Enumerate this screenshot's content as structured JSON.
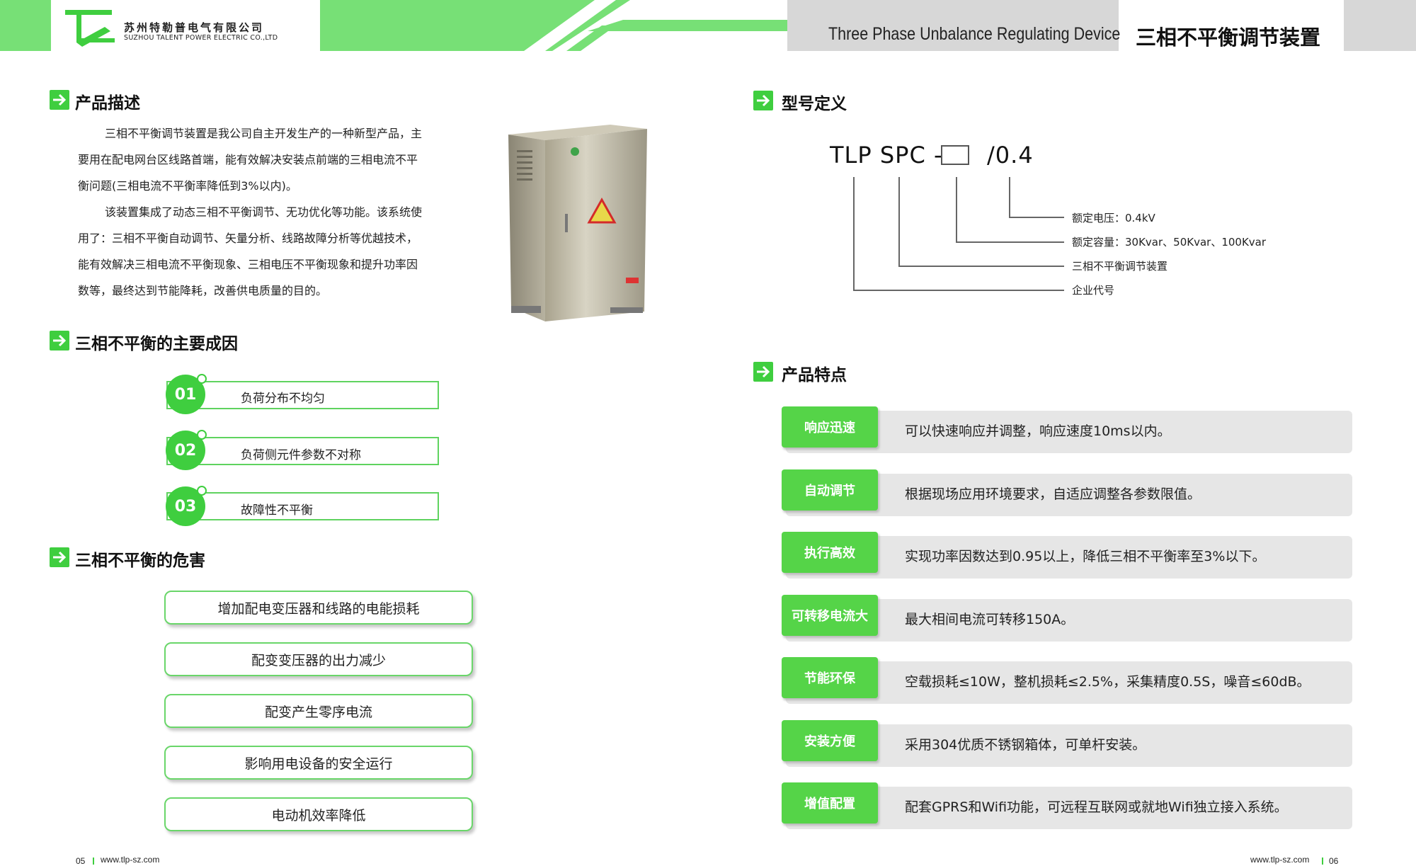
{
  "header": {
    "company_cn": "苏州特勒普电气有限公司",
    "company_en": "SUZHOU TALENT POWER ELECTRIC CO.,LTD",
    "title_en": "Three Phase Unbalance Regulating Device",
    "title_cn": "三相不平衡调节装置"
  },
  "description": {
    "title": "产品描述",
    "p1_l1": "三相不平衡调节装置是我公司自主开发生产的一种新型产品，主",
    "p1_l2": "要用在配电网台区线路首端，能有效解决安装点前端的三相电流不平",
    "p1_l3": "衡问题(三相电流不平衡率降低到3%以内)。",
    "p2_l1": "该装置集成了动态三相不平衡调节、无功优化等功能。该系统使",
    "p2_l2": "用了：三相不平衡自动调节、矢量分析、线路故障分析等优越技术，",
    "p2_l3": "能有效解决三相电流不平衡现象、三相电压不平衡现象和提升功率因",
    "p2_l4": "数等，最终达到节能降耗，改善供电质量的目的。"
  },
  "causes": {
    "title": "三相不平衡的主要成因",
    "items": [
      {
        "num": "01",
        "text": "负荷分布不均匀"
      },
      {
        "num": "02",
        "text": "负荷侧元件参数不对称"
      },
      {
        "num": "03",
        "text": "故障性不平衡"
      }
    ]
  },
  "harms": {
    "title": "三相不平衡的危害",
    "items": [
      "增加配电变压器和线路的电能损耗",
      "配变变压器的出力减少",
      "配变产生零序电流",
      "影响用电设备的安全运行",
      "电动机效率降低"
    ]
  },
  "model": {
    "title": "型号定义",
    "prefix": "TLP SPC -",
    "suffix": "/0.4",
    "labels": [
      "额定电压：0.4kV",
      "额定容量：30Kvar、50Kvar、100Kvar",
      "三相不平衡调节装置",
      "企业代号"
    ]
  },
  "features": {
    "title": "产品特点",
    "items": [
      {
        "tag": "响应迅速",
        "text": "可以快速响应并调整，响应速度10ms以内。"
      },
      {
        "tag": "自动调节",
        "text": "根据现场应用环境要求，自适应调整各参数限值。"
      },
      {
        "tag": "执行高效",
        "text": "实现功率因数达到0.95以上，降低三相不平衡率至3%以下。"
      },
      {
        "tag": "可转移电流大",
        "text": "最大相间电流可转移150A。"
      },
      {
        "tag": "节能环保",
        "text": "空载损耗≤10W，整机损耗≤2.5%，采集精度0.5S，噪音≤60dB。"
      },
      {
        "tag": "安装方便",
        "text": "采用304优质不锈钢箱体，可单杆安装。"
      },
      {
        "tag": "增值配置",
        "text": "配套GPRS和Wifi功能，可远程互联网或就地Wifi独立接入系统。"
      }
    ]
  },
  "footer": {
    "left_page": "05",
    "left_url": "www.tlp-sz.com",
    "right_url": "www.tlp-sz.com",
    "right_page": "06"
  },
  "colors": {
    "accent": "#3fce3f",
    "header_green": "#77e076",
    "header_grey": "#d7d7d7"
  }
}
